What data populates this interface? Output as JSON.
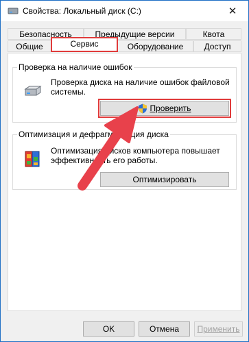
{
  "window": {
    "title": "Свойства: Локальный диск (C:)",
    "close_glyph": "✕"
  },
  "tabs_row1": [
    {
      "label": "Безопасность"
    },
    {
      "label": "Предыдущие версии"
    },
    {
      "label": "Квота"
    }
  ],
  "tabs_row2": [
    {
      "label": "Общие"
    },
    {
      "label": "Сервис",
      "active": true
    },
    {
      "label": "Оборудование"
    },
    {
      "label": "Доступ"
    }
  ],
  "error_check": {
    "title": "Проверка на наличие ошибок",
    "description_line1": "Проверка диска на наличие ошибок файловой",
    "description_line2": "системы.",
    "button_label": "Проверить",
    "icon": "drive-icon"
  },
  "optimize": {
    "title": "Оптимизация и дефрагментация диска",
    "description_line1": "Оптимизация дисков компьютера повышает",
    "description_line2": "эффективность его работы.",
    "button_label": "Оптимизировать",
    "icon": "defrag-icon"
  },
  "footer": {
    "ok_label": "OK",
    "cancel_label": "Отмена",
    "apply_label": "Применить"
  },
  "colors": {
    "highlight": "#e03b3b",
    "arrow": "#e8414b",
    "border_accent": "#1e6fc5"
  }
}
